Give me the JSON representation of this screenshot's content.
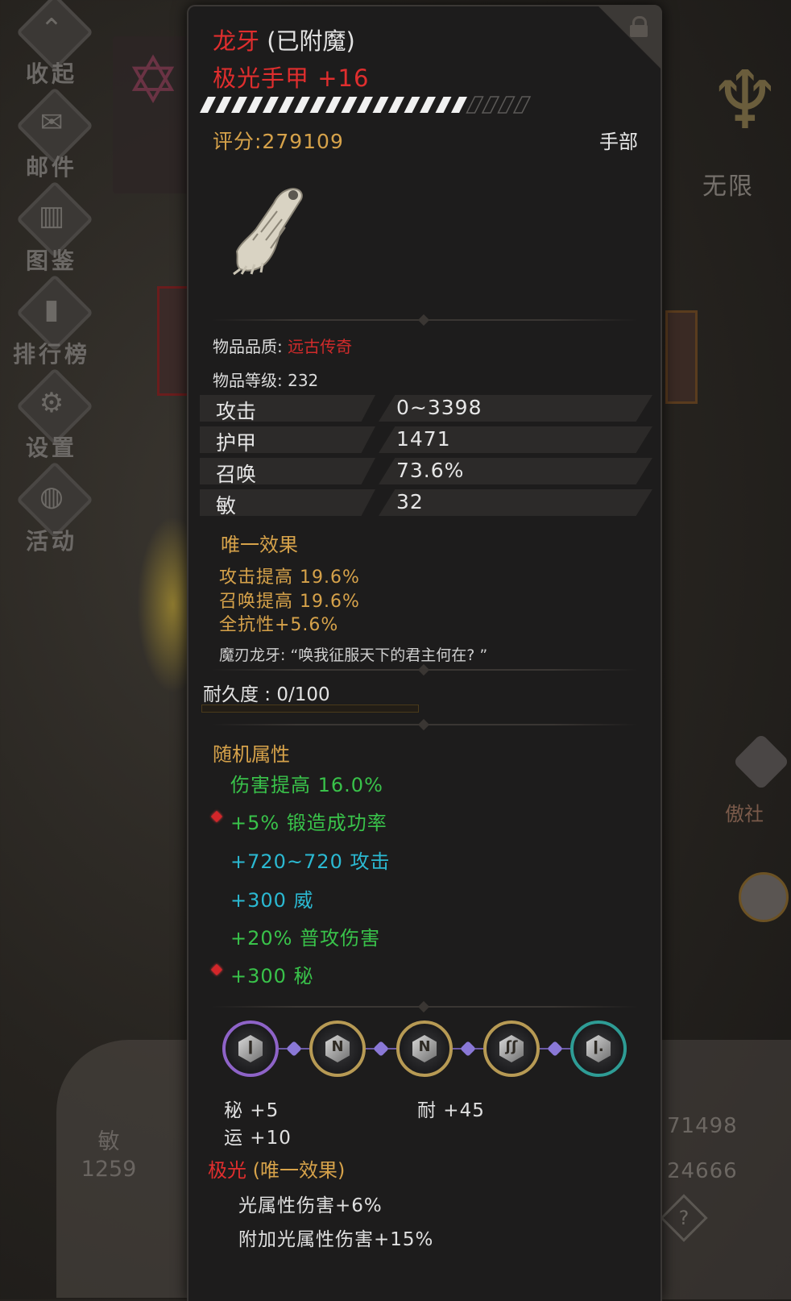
{
  "side_menu": [
    {
      "label": "收起",
      "icon": "collapse-icon"
    },
    {
      "label": "邮件",
      "icon": "mail-icon"
    },
    {
      "label": "图鉴",
      "icon": "book-icon"
    },
    {
      "label": "排行榜",
      "icon": "ranking-icon"
    },
    {
      "label": "设置",
      "icon": "gear-icon"
    },
    {
      "label": "活动",
      "icon": "event-icon"
    }
  ],
  "background": {
    "right_label": "无限",
    "right_badge": "傲社",
    "left_stat_label": "敏",
    "left_stat_value": "1259",
    "right_num_1": "71498",
    "right_num_2": "24666",
    "help_glyph": "?"
  },
  "item": {
    "enchant_name": "龙牙",
    "enchant_suffix": "(已附魔)",
    "name": "极光手甲 +16",
    "score_label": "评分:279109",
    "slot": "手部",
    "quality_label": "物品品质:",
    "quality_value": "远古传奇",
    "quality_color": "#d12b2b",
    "level_label": "物品等级: 232",
    "stats": [
      {
        "name": "攻击",
        "value": "0~3398"
      },
      {
        "name": "护甲",
        "value": "1471"
      },
      {
        "name": "召唤",
        "value": "73.6%"
      },
      {
        "name": "敏",
        "value": "32"
      }
    ],
    "unique_title": "唯一效果",
    "unique_effects": [
      "攻击提高 19.6%",
      "召唤提高 19.6%",
      "全抗性+5.6%"
    ],
    "quote": "魔刃龙牙: “唤我征服天下的君主何在? ”",
    "durability_label": "耐久度 : 0/100",
    "durability": {
      "current": 0,
      "max": 100
    },
    "random_title": "随机属性",
    "random_affixes": [
      {
        "text": "伤害提高 16.0%",
        "color": "green",
        "marker": false
      },
      {
        "text": "+5% 锻造成功率",
        "color": "green",
        "marker": true
      },
      {
        "text": "+720~720 攻击",
        "color": "cyan",
        "marker": false
      },
      {
        "text": "+300 威",
        "color": "cyan",
        "marker": false
      },
      {
        "text": "+20% 普攻伤害",
        "color": "green",
        "marker": false
      },
      {
        "text": "+300 秘",
        "color": "green",
        "marker": true
      }
    ],
    "sockets": [
      {
        "rune": "ǀ",
        "frame": "purple"
      },
      {
        "rune": "N",
        "frame": "gold"
      },
      {
        "rune": "N",
        "frame": "gold"
      },
      {
        "rune": "ʃʃ",
        "frame": "gold"
      },
      {
        "rune": "ǀ.",
        "frame": "teal"
      }
    ],
    "socket_stats": {
      "s1": "秘  +5",
      "s2": "耐  +45",
      "s3": "运  +10"
    },
    "aurora_name": "极光",
    "aurora_suffix": "(唯一效果)",
    "aurora_effects": [
      "光属性伤害+6%",
      "附加光属性伤害+15%"
    ],
    "enhance_progress_segments": {
      "filled": 17,
      "total": 21
    }
  },
  "colors": {
    "red": "#e02e2e",
    "gold": "#d6a24a",
    "green": "#39c24a",
    "cyan": "#2bb9d2"
  }
}
